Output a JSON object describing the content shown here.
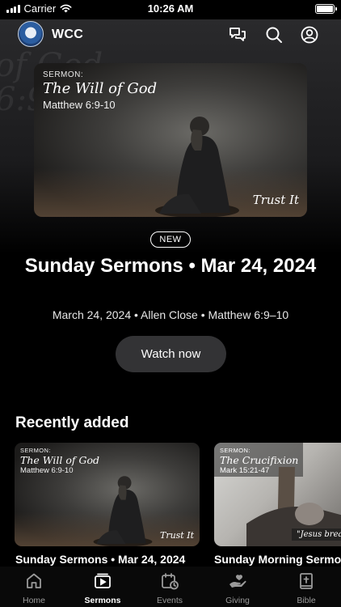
{
  "status_bar": {
    "carrier": "Carrier",
    "time": "10:26 AM",
    "battery_percent": 100
  },
  "backdrop": {
    "line1": "of God",
    "line2": "6:9-"
  },
  "app": {
    "name": "WCC",
    "icons": [
      "chat-icon",
      "search-icon",
      "profile-icon"
    ]
  },
  "hero": {
    "artwork": {
      "label": "SERMON:",
      "title": "The Will of God",
      "reference": "Matthew 6:9-10",
      "caption": "Trust It"
    },
    "badge": "NEW",
    "title": "Sunday Sermons • Mar 24, 2024",
    "meta": "March 24, 2024 • Allen Close • Matthew 6:9–10",
    "watch_label": "Watch now"
  },
  "recently_added": {
    "heading": "Recently added",
    "items": [
      {
        "label": "SERMON:",
        "art_title": "The Will of God",
        "reference": "Matthew 6:9-10",
        "caption": "Trust It",
        "title": "Sunday Sermons • Mar 24, 2024"
      },
      {
        "label": "SERMON:",
        "art_title": "The Crucifixion",
        "reference": "Mark 15:21-47",
        "caption": "\"Jesus brea",
        "title": "Sunday Morning Sermo"
      }
    ]
  },
  "tabs": [
    {
      "label": "Home",
      "icon": "home-icon",
      "active": false
    },
    {
      "label": "Sermons",
      "icon": "video-icon",
      "active": true
    },
    {
      "label": "Events",
      "icon": "calendar-icon",
      "active": false
    },
    {
      "label": "Giving",
      "icon": "giving-icon",
      "active": false
    },
    {
      "label": "Bible",
      "icon": "bible-icon",
      "active": false
    }
  ]
}
